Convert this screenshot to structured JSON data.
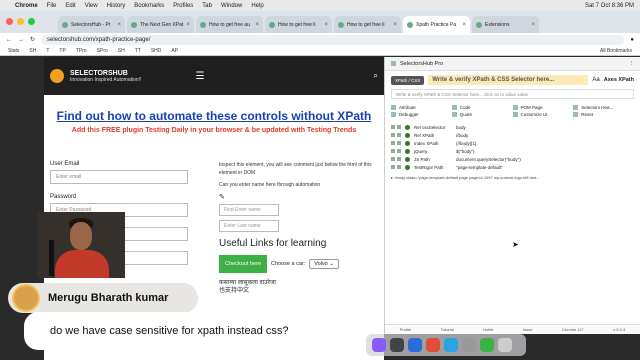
{
  "menubar": {
    "items": [
      "Chrome",
      "File",
      "Edit",
      "View",
      "History",
      "Bookmarks",
      "Profiles",
      "Tab",
      "Window",
      "Help"
    ],
    "clock": "Sat 7 Oct 8:36 PM"
  },
  "tabs": [
    {
      "label": "SelectorsHub - Pr",
      "active": false
    },
    {
      "label": "The Next Gen XPat",
      "active": false
    },
    {
      "label": "How to get free au",
      "active": false
    },
    {
      "label": "How to get free li",
      "active": false
    },
    {
      "label": "How to get free li",
      "active": false
    },
    {
      "label": "Xpath Practice Pa",
      "active": true
    },
    {
      "label": "Extensions",
      "active": false
    }
  ],
  "address": {
    "url": "selectorshub.com/xpath-practice-page/"
  },
  "bookmarks": {
    "items": [
      "Stats",
      "SH",
      "T",
      "TP",
      "TPro",
      "SPro",
      "SH",
      "TT",
      "SHD",
      "AP"
    ],
    "all_label": "All Bookmarks"
  },
  "site": {
    "brand_name": "SELECTORSHUB",
    "tagline": "Innovation Inspired Automation!!",
    "headline": "Find out how to automate these controls without XPath",
    "subhead": "Add this FREE plugin Testing Daily in your browser & be updated with Testing Trends",
    "user_email_label": "User Email",
    "email_placeholder": "Enter email",
    "password_label": "Password",
    "password_placeholder": "Enter Password",
    "inspect_hint": "Inspect this element, you will see comment just below the html of this element in DOM",
    "name_hint": "Can you enter name here through automation",
    "first_name_placeholder": "First Enter name",
    "last_name_placeholder": "Enter Last name",
    "links_title": "Useful Links for learning",
    "checkout_label": "Checkout here",
    "car_label": "Choose a car:",
    "car_value": "Volvo",
    "foreign_line1": "कसाय्या लासुकला दाउरेजा",
    "foreign_line2": "也支持中文"
  },
  "devtools": {
    "header_title": "SelectorsHub Pro",
    "mode_pill": "XPath / CSS",
    "title_label": "Write & verify XPath & CSS Selector here...",
    "case_toggle": "Aa",
    "axes_label": "Axes XPath",
    "input_placeholder": "Write & verify XPath & CSS Selector here... click on to value value",
    "menu": [
      "Attribute",
      "Code",
      "POM Page",
      "Selectors Hea...",
      "Debugger",
      "Quote",
      "Customize UI",
      "Reset"
    ],
    "rows": [
      {
        "key": "Rel cssSelector",
        "value": "body"
      },
      {
        "key": "Rel XPath",
        "value": "//body"
      },
      {
        "key": "Index XPath",
        "value": "(//body)[1]"
      },
      {
        "key": "jQuery",
        "value": "$(\"body\")"
      },
      {
        "key": "JS Path",
        "value": "document.querySelector(\"body\")"
      },
      {
        "key": "TestRigor Path",
        "value": "\"page-template-default\""
      }
    ],
    "dom_snippet": "▸ <body class=\"page-template-default page page-id-1097 wp-custom-logo elif-hea...",
    "footer": [
      "Profile",
      "Tutorial",
      "Hotfix",
      "Issue",
      "Chrome 117",
      "v 5.0.3"
    ]
  },
  "overlay": {
    "presenter_name": "Merugu Bharath kumar",
    "question": "do we have case sensitive for xpath instead css?"
  },
  "colors": {
    "headline": "#1a3fb5",
    "subhead": "#e03a2a",
    "button": "#3cb043",
    "header": "#1f1f1f"
  }
}
